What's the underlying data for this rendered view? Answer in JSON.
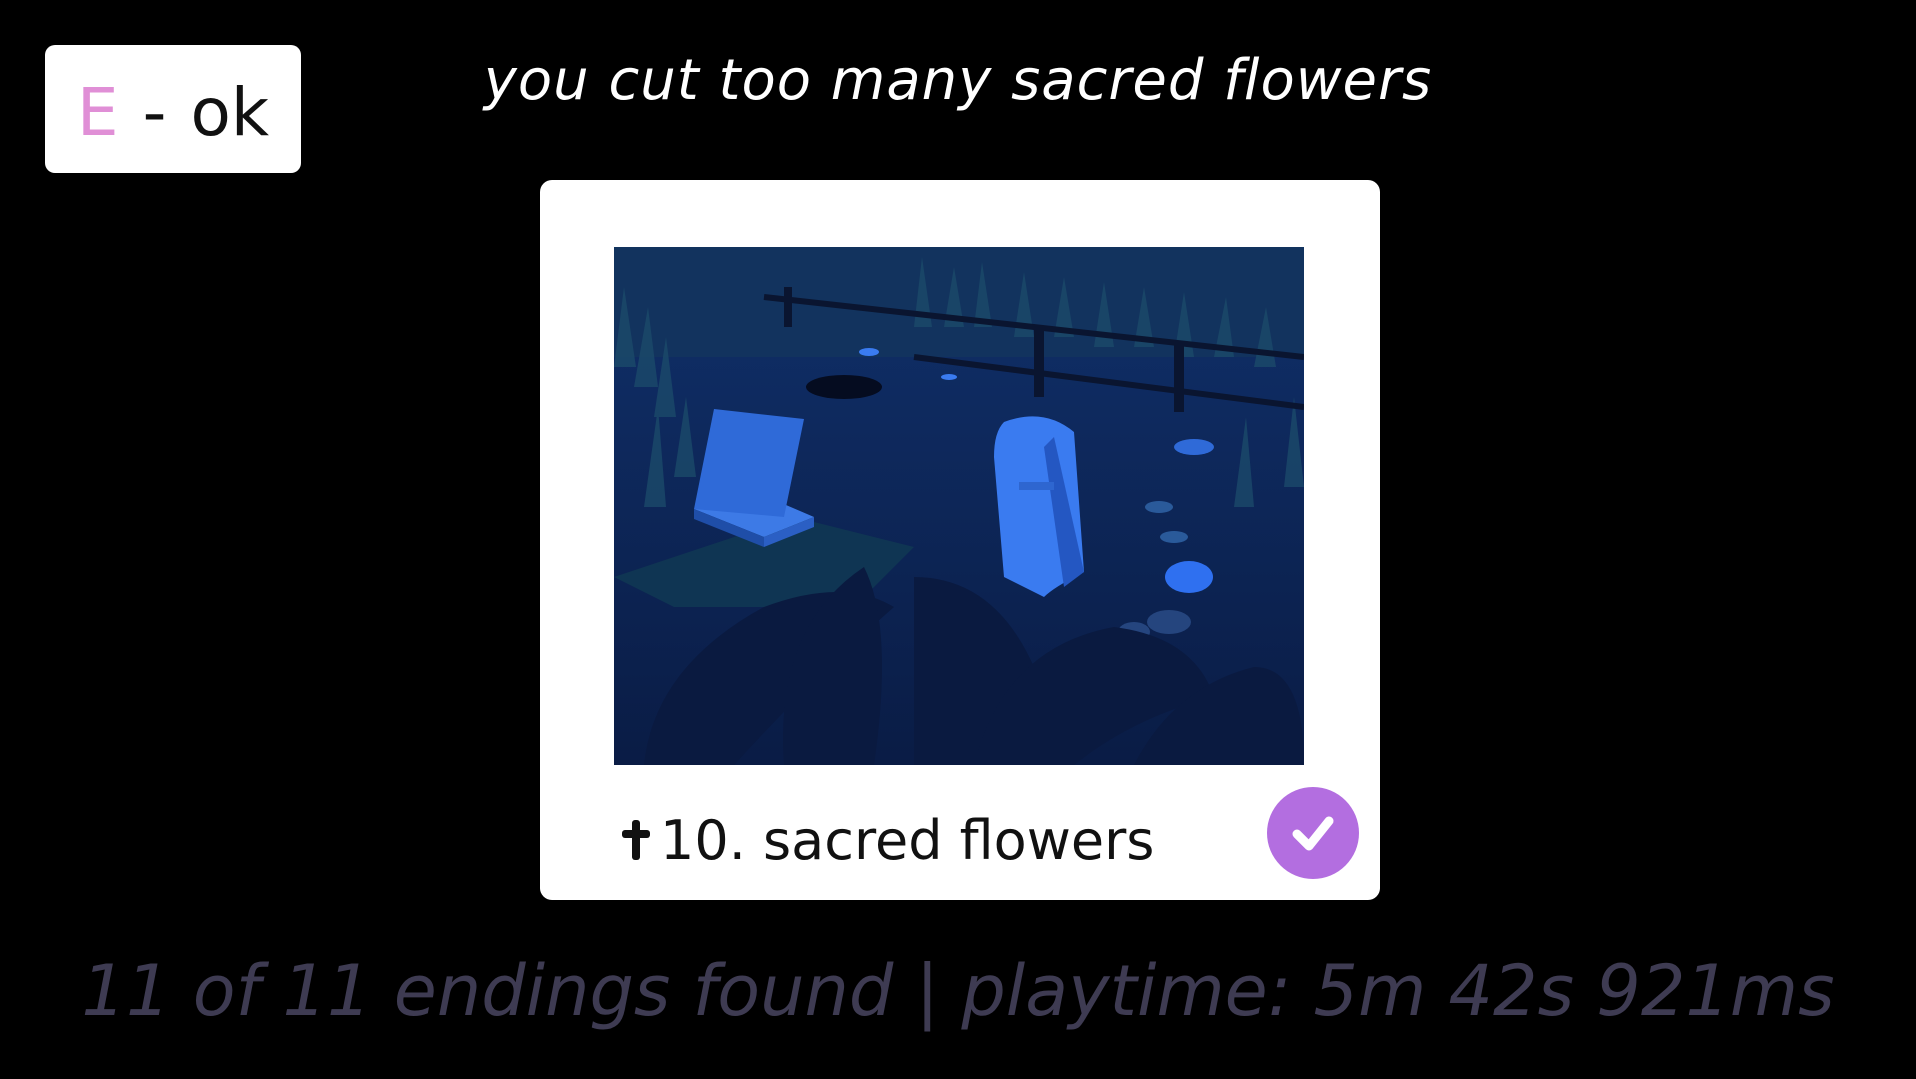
{
  "hint": {
    "key": "E",
    "separator": "-",
    "action": "ok"
  },
  "headline": "you cut too many sacred flowers",
  "ending": {
    "number_title": "10. sacred flowers",
    "completed": true
  },
  "footer": {
    "summary": "11 of 11 endings found | playtime: 5m 42s 921ms"
  },
  "colors": {
    "background": "#000000",
    "card": "#ffffff",
    "key_accent": "#e08fd6",
    "check_badge": "#b36ee0",
    "footer_text": "#3e3b52"
  },
  "icons": {
    "ending_marker": "cross-icon",
    "completed_badge": "checkmark-icon"
  }
}
